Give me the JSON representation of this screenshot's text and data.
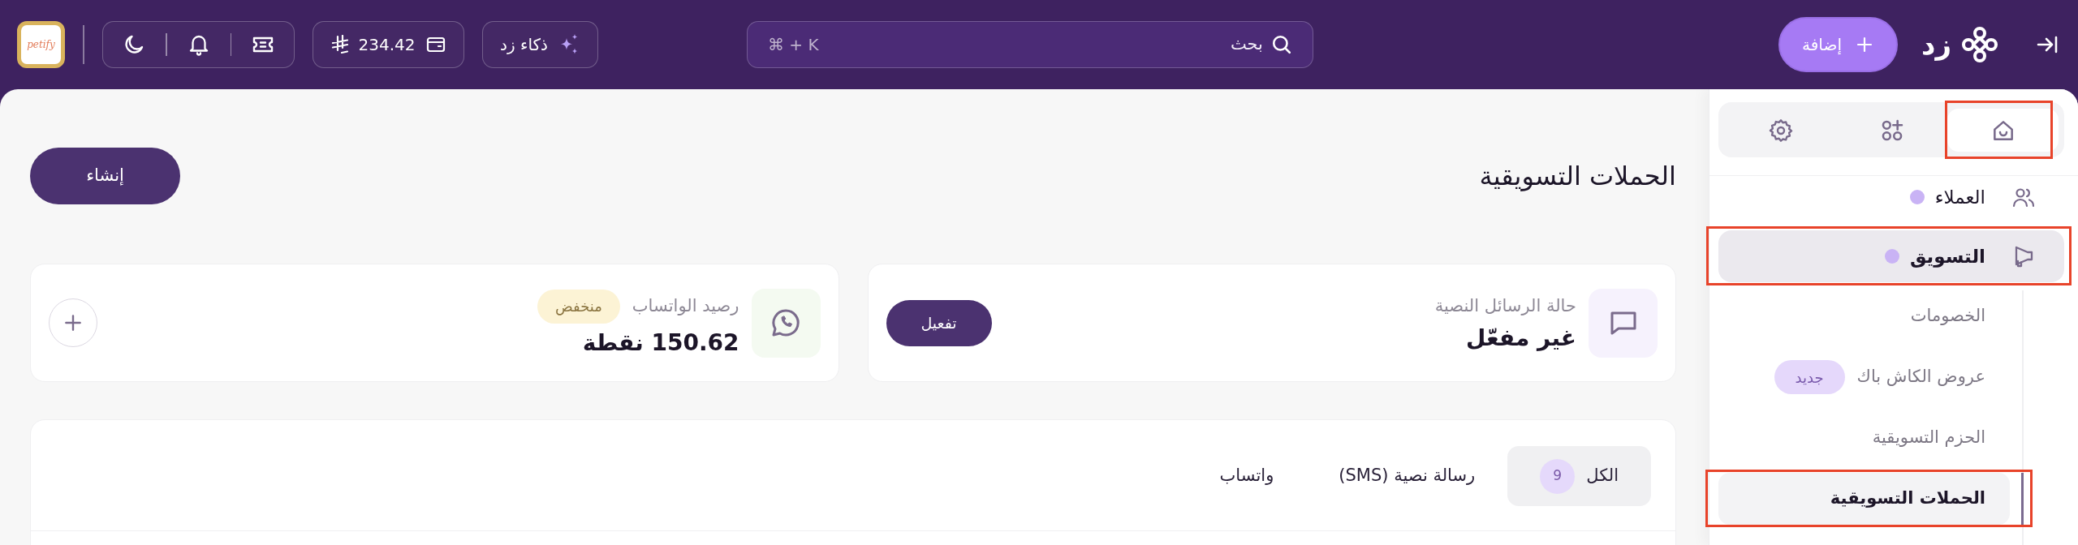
{
  "topbar": {
    "logo": {
      "text": "زد"
    },
    "add_button": {
      "label": "إضافة"
    },
    "search": {
      "placeholder": "بحث",
      "shortcut": "⌘ + K"
    },
    "ai_button": {
      "label": "ذكاء زد"
    },
    "balance": {
      "amount": "234.42"
    },
    "store": {
      "text": "petify"
    }
  },
  "sidebar": {
    "segments": [
      {
        "kind": "home",
        "selected": true,
        "highlighted": true
      },
      {
        "kind": "apps",
        "selected": false,
        "highlighted": false
      },
      {
        "kind": "settings",
        "selected": false,
        "highlighted": false
      }
    ],
    "items": [
      {
        "kind": "customers",
        "label": "العملاء",
        "notified": true,
        "selected": false,
        "highlighted": false
      },
      {
        "kind": "marketing",
        "label": "التسويق",
        "notified": true,
        "selected": true,
        "highlighted": true,
        "children": [
          {
            "label": "الخصومات",
            "selected": false,
            "highlighted": false
          },
          {
            "label": "عروض الكاش باك",
            "badge": "جديد",
            "selected": false,
            "highlighted": false
          },
          {
            "label": "الحزم التسويقية",
            "selected": false,
            "highlighted": false
          },
          {
            "label": "الحملات التسويقية",
            "selected": true,
            "highlighted": true
          }
        ]
      }
    ]
  },
  "main": {
    "title": "الحملات التسويقية",
    "create_button": {
      "label": "إنشاء"
    },
    "cards": [
      {
        "kind": "sms",
        "label": "حالة الرسائل النصية",
        "value": "غير مفعّل",
        "action": {
          "kind": "button",
          "label": "تفعيل"
        }
      },
      {
        "kind": "whatsapp",
        "label": "رصيد الواتساب",
        "badge": "منخفض",
        "value": "150.62 نقطة",
        "action": {
          "kind": "add"
        }
      }
    ],
    "tabs": [
      {
        "label": "الكل",
        "count": "9",
        "selected": true
      },
      {
        "label": "رسالة نصية (SMS)",
        "selected": false
      },
      {
        "label": "واتساب",
        "selected": false
      }
    ]
  }
}
